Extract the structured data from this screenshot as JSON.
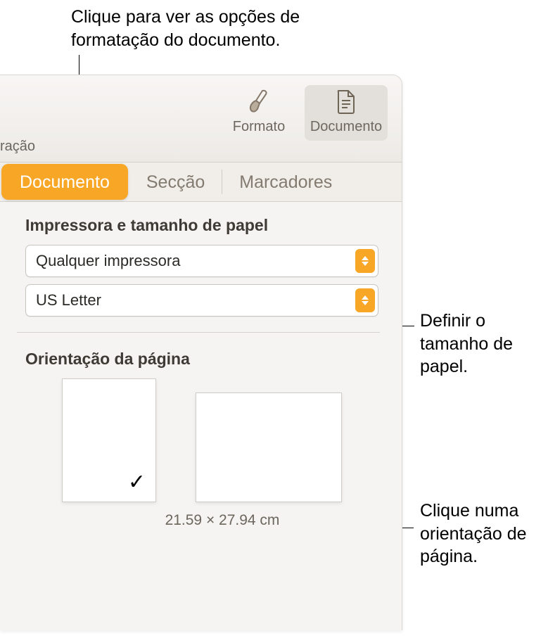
{
  "callouts": {
    "topTab": "Clique para ver as opções de formatação do documento.",
    "paperSize": "Definir o tamanho de papel.",
    "orientation": "Clique numa orientação de página."
  },
  "titlebar": {
    "fragment": "ração",
    "format": {
      "label": "Formato"
    },
    "document": {
      "label": "Documento"
    }
  },
  "tabs": {
    "documento": "Documento",
    "seccao": "Secção",
    "marcadores": "Marcadores"
  },
  "sections": {
    "printerPaper": {
      "title": "Impressora e tamanho de papel",
      "printer": "Qualquer impressora",
      "paper": "US Letter"
    },
    "orientation": {
      "title": "Orientação da página",
      "dimensions": "21.59 × 27.94 cm",
      "checkmark": "✓"
    }
  }
}
